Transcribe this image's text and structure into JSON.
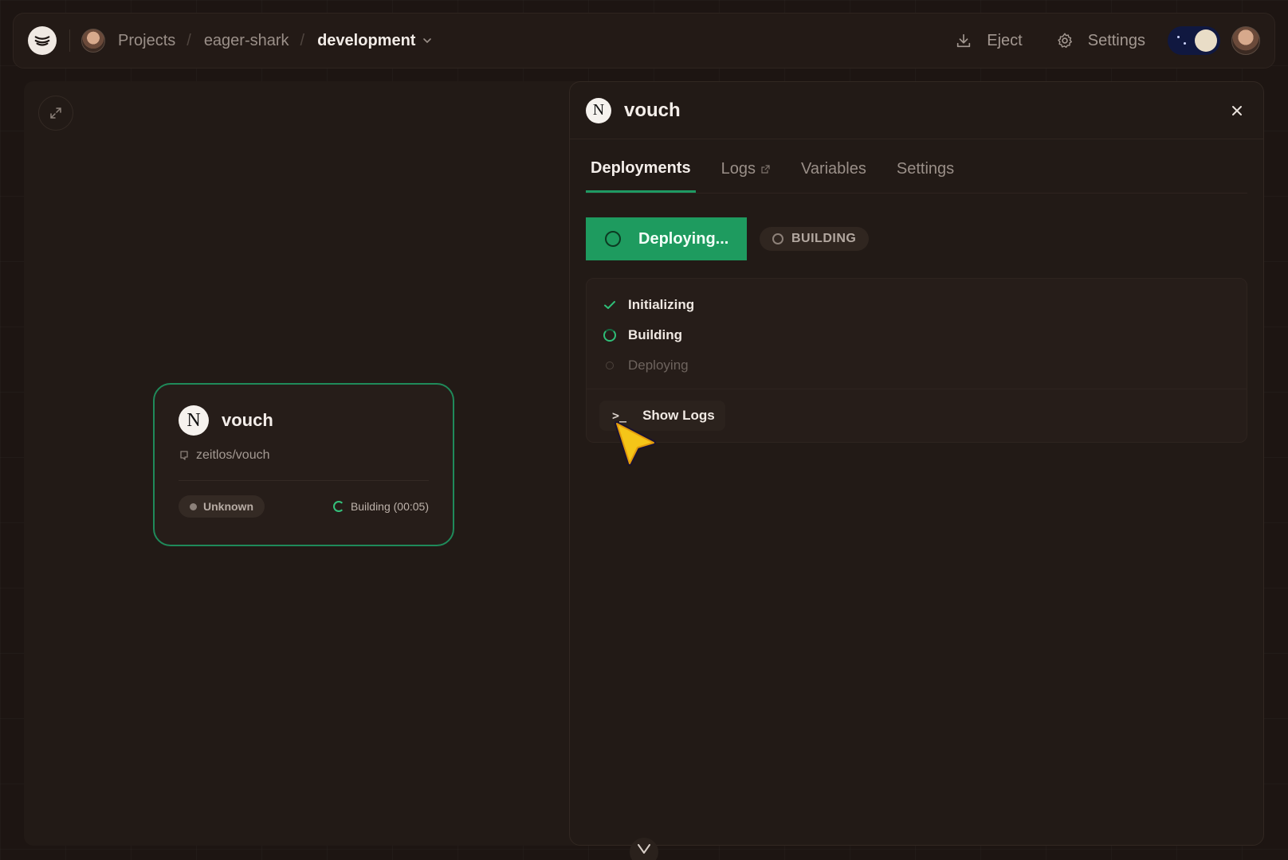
{
  "topbar": {
    "breadcrumbs": [
      "Projects",
      "eager-shark",
      "development"
    ],
    "eject_label": "Eject",
    "settings_label": "Settings"
  },
  "canvas": {
    "card": {
      "title": "vouch",
      "logo_letter": "N",
      "repo": "zeitlos/vouch",
      "status_pill": "Unknown",
      "build_status": "Building (00:05)"
    }
  },
  "panel": {
    "title": "vouch",
    "logo_letter": "N",
    "tabs": [
      {
        "label": "Deployments",
        "active": true
      },
      {
        "label": "Logs",
        "active": false,
        "external": true
      },
      {
        "label": "Variables",
        "active": false
      },
      {
        "label": "Settings",
        "active": false
      }
    ],
    "deploy_button": "Deploying...",
    "status_badge": "BUILDING",
    "steps": [
      {
        "label": "Initializing",
        "state": "done"
      },
      {
        "label": "Building",
        "state": "running"
      },
      {
        "label": "Deploying",
        "state": "pending"
      }
    ],
    "show_logs_label": "Show Logs",
    "show_logs_glyph": ">_"
  },
  "colors": {
    "accent_green": "#1e9b5f",
    "background": "#1d1512",
    "panel": "#221a16"
  },
  "icons": [
    "railway-logo-icon",
    "avatar",
    "chevron-down-icon",
    "download-icon",
    "gear-icon",
    "theme-toggle",
    "expand-icon",
    "nextjs-icon",
    "github-icon",
    "close-icon",
    "external-link-icon",
    "check-icon",
    "spinner-icon",
    "terminal-icon",
    "cursor-icon"
  ]
}
